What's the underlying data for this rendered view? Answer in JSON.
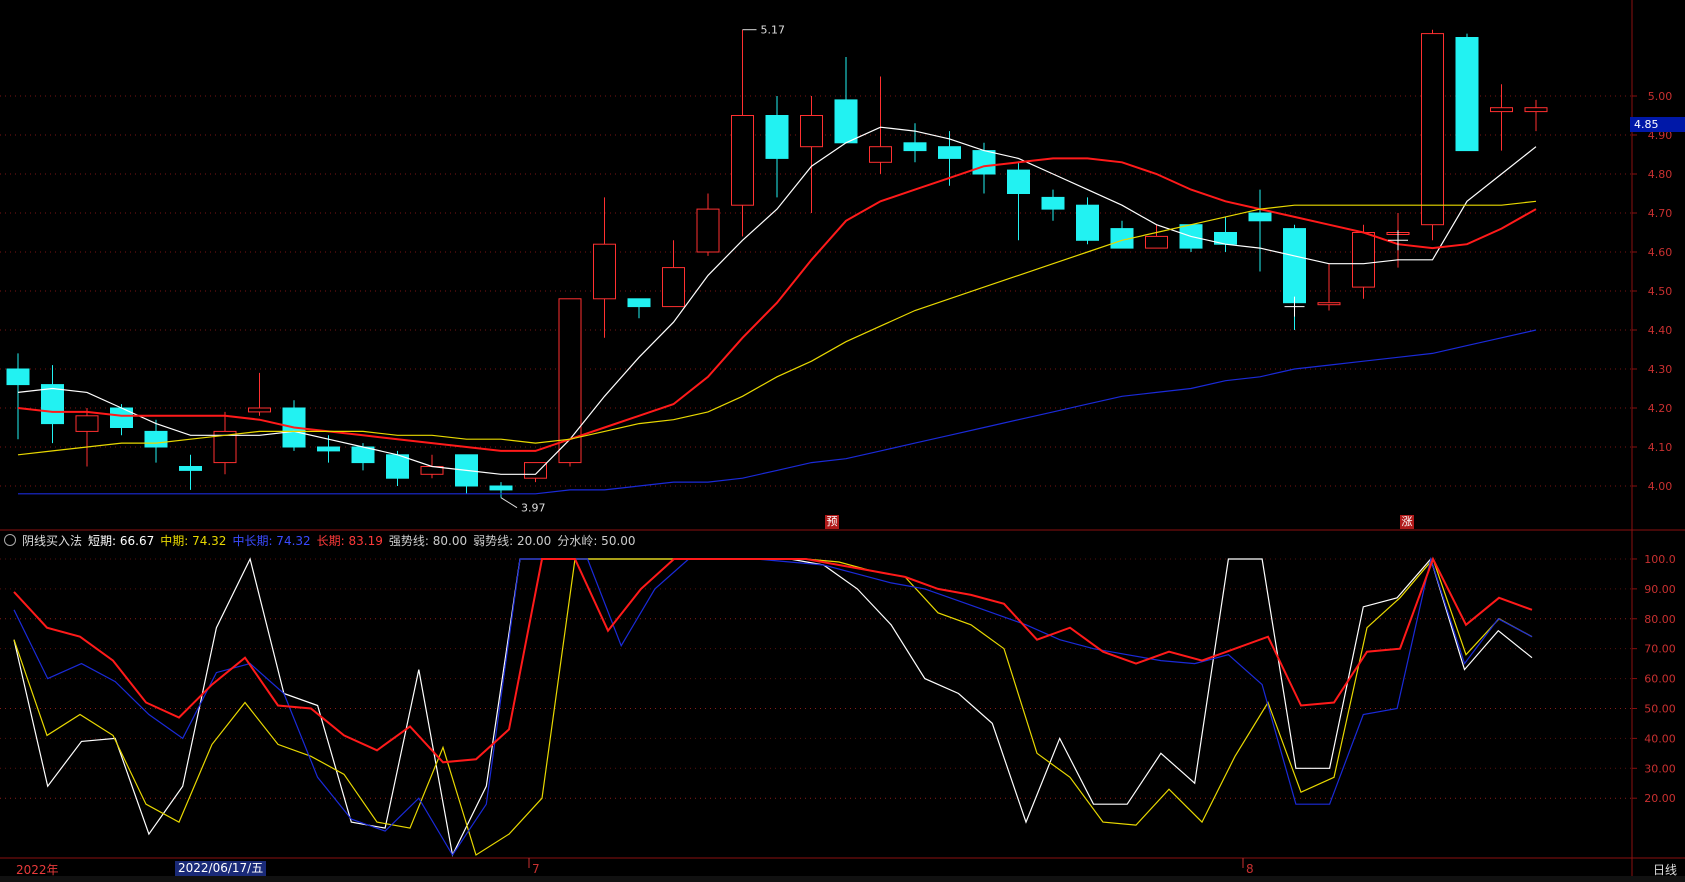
{
  "chart_data": [
    {
      "type": "candlestick",
      "ylim": [
        3.9,
        5.2
      ],
      "ticks": [
        "5.00",
        "4.90",
        "4.80",
        "4.70",
        "4.60",
        "4.50",
        "4.40",
        "4.30",
        "4.20",
        "4.10",
        "4.00"
      ],
      "tick_values": [
        5.0,
        4.9,
        4.8,
        4.7,
        4.6,
        4.5,
        4.4,
        4.3,
        4.2,
        4.1,
        4.0
      ],
      "grid": true,
      "current_price": "4.85",
      "high_label": "5.17",
      "low_label": "3.97",
      "ohlc": [
        [
          4.3,
          4.34,
          4.12,
          4.26
        ],
        [
          4.26,
          4.31,
          4.11,
          4.16
        ],
        [
          4.14,
          4.2,
          4.05,
          4.18
        ],
        [
          4.2,
          4.21,
          4.13,
          4.15
        ],
        [
          4.14,
          4.17,
          4.06,
          4.1
        ],
        [
          4.05,
          4.08,
          3.99,
          4.04
        ],
        [
          4.06,
          4.19,
          4.03,
          4.14
        ],
        [
          4.19,
          4.29,
          4.18,
          4.2
        ],
        [
          4.2,
          4.22,
          4.09,
          4.1
        ],
        [
          4.1,
          4.13,
          4.06,
          4.09
        ],
        [
          4.1,
          4.11,
          4.04,
          4.06
        ],
        [
          4.08,
          4.09,
          4.0,
          4.02
        ],
        [
          4.03,
          4.08,
          4.02,
          4.05
        ],
        [
          4.08,
          4.08,
          3.98,
          4.0
        ],
        [
          4.0,
          4.01,
          3.97,
          3.99
        ],
        [
          4.02,
          4.06,
          4.01,
          4.06
        ],
        [
          4.06,
          4.48,
          4.05,
          4.48
        ],
        [
          4.48,
          4.74,
          4.38,
          4.62
        ],
        [
          4.48,
          4.47,
          4.43,
          4.46
        ],
        [
          4.46,
          4.63,
          4.47,
          4.56
        ],
        [
          4.6,
          4.75,
          4.59,
          4.71
        ],
        [
          4.72,
          5.17,
          4.64,
          4.95
        ],
        [
          4.95,
          5.0,
          4.74,
          4.84
        ],
        [
          4.87,
          5.0,
          4.7,
          4.95
        ],
        [
          4.99,
          5.1,
          4.88,
          4.88
        ],
        [
          4.83,
          5.05,
          4.8,
          4.87
        ],
        [
          4.88,
          4.93,
          4.83,
          4.86
        ],
        [
          4.87,
          4.91,
          4.77,
          4.84
        ],
        [
          4.86,
          4.88,
          4.75,
          4.8
        ],
        [
          4.81,
          4.83,
          4.63,
          4.75
        ],
        [
          4.74,
          4.76,
          4.68,
          4.71
        ],
        [
          4.72,
          4.74,
          4.62,
          4.63
        ],
        [
          4.66,
          4.68,
          4.62,
          4.61
        ],
        [
          4.61,
          4.67,
          4.61,
          4.64
        ],
        [
          4.67,
          4.67,
          4.6,
          4.61
        ],
        [
          4.65,
          4.69,
          4.6,
          4.62
        ],
        [
          4.7,
          4.76,
          4.55,
          4.68
        ],
        [
          4.66,
          4.67,
          4.4,
          4.47
        ],
        [
          4.47,
          4.57,
          4.45,
          4.47
        ],
        [
          4.51,
          4.67,
          4.48,
          4.65
        ],
        [
          4.65,
          4.7,
          4.56,
          4.65
        ],
        [
          4.67,
          5.17,
          4.63,
          5.16
        ],
        [
          5.15,
          5.16,
          4.86,
          4.86
        ],
        [
          4.96,
          5.03,
          4.86,
          4.97
        ],
        [
          4.96,
          4.99,
          4.91,
          4.97
        ]
      ],
      "series": [
        {
          "name": "MA5",
          "color": "#ffffff",
          "values": [
            4.24,
            4.25,
            4.24,
            4.2,
            4.16,
            4.13,
            4.13,
            4.13,
            4.14,
            4.12,
            4.1,
            4.08,
            4.05,
            4.04,
            4.03,
            4.03,
            4.12,
            4.23,
            4.33,
            4.42,
            4.54,
            4.63,
            4.71,
            4.82,
            4.88,
            4.92,
            4.91,
            4.89,
            4.86,
            4.84,
            4.8,
            4.76,
            4.72,
            4.67,
            4.64,
            4.62,
            4.61,
            4.59,
            4.57,
            4.57,
            4.58,
            4.58,
            4.73,
            4.8,
            4.87
          ]
        },
        {
          "name": "MA10",
          "color": "#ff1a1a",
          "values": [
            4.2,
            4.19,
            4.19,
            4.18,
            4.18,
            4.18,
            4.18,
            4.17,
            4.15,
            4.14,
            4.13,
            4.12,
            4.11,
            4.1,
            4.09,
            4.09,
            4.12,
            4.15,
            4.18,
            4.21,
            4.28,
            4.38,
            4.47,
            4.58,
            4.68,
            4.73,
            4.76,
            4.79,
            4.82,
            4.83,
            4.84,
            4.84,
            4.83,
            4.8,
            4.76,
            4.73,
            4.71,
            4.69,
            4.67,
            4.65,
            4.62,
            4.61,
            4.62,
            4.66,
            4.71
          ]
        },
        {
          "name": "MA20",
          "color": "#e8d800",
          "values": [
            4.08,
            4.09,
            4.1,
            4.11,
            4.11,
            4.12,
            4.13,
            4.14,
            4.14,
            4.14,
            4.14,
            4.13,
            4.13,
            4.12,
            4.12,
            4.11,
            4.12,
            4.14,
            4.16,
            4.17,
            4.19,
            4.23,
            4.28,
            4.32,
            4.37,
            4.41,
            4.45,
            4.48,
            4.51,
            4.54,
            4.57,
            4.6,
            4.63,
            4.65,
            4.67,
            4.69,
            4.71,
            4.72,
            4.72,
            4.72,
            4.72,
            4.72,
            4.72,
            4.72,
            4.73
          ]
        },
        {
          "name": "MA60",
          "color": "#1a2ad8",
          "values": [
            3.98,
            3.98,
            3.98,
            3.98,
            3.98,
            3.98,
            3.98,
            3.98,
            3.98,
            3.98,
            3.98,
            3.98,
            3.98,
            3.98,
            3.98,
            3.98,
            3.99,
            3.99,
            4.0,
            4.01,
            4.01,
            4.02,
            4.04,
            4.06,
            4.07,
            4.09,
            4.11,
            4.13,
            4.15,
            4.17,
            4.19,
            4.21,
            4.23,
            4.24,
            4.25,
            4.27,
            4.28,
            4.3,
            4.31,
            4.32,
            4.33,
            4.34,
            4.36,
            4.38,
            4.4
          ]
        }
      ],
      "signals": [
        {
          "label": "预",
          "index": 23
        },
        {
          "label": "涨",
          "index": 41
        }
      ]
    },
    {
      "type": "line",
      "title": "阴线买入法",
      "ylim": [
        0,
        103
      ],
      "ticks": [
        "100.0",
        "90.00",
        "80.00",
        "70.00",
        "60.00",
        "50.00",
        "40.00",
        "30.00",
        "20.00"
      ],
      "tick_values": [
        100,
        90,
        80,
        70,
        60,
        50,
        40,
        30,
        20
      ],
      "reference_lines": [
        80,
        50,
        20
      ],
      "legend": [
        {
          "label": "短期: 66.67",
          "color": "#ffffff"
        },
        {
          "label": "中期: 74.32",
          "color": "#e8d800"
        },
        {
          "label": "中长期: 74.32",
          "color": "#2a3aff"
        },
        {
          "label": "长期: 83.19",
          "color": "#ff2a2a"
        },
        {
          "label": "强势线: 80.00",
          "color": "#cccccc"
        },
        {
          "label": "弱势线: 20.00",
          "color": "#cccccc"
        },
        {
          "label": "分水岭: 50.00",
          "color": "#cccccc"
        }
      ],
      "series": [
        {
          "name": "短期",
          "color": "#ffffff",
          "values": [
            73,
            24,
            39,
            40,
            8,
            24,
            77,
            100,
            55,
            51,
            12,
            10,
            63,
            1,
            24,
            100,
            100,
            100,
            100,
            100,
            100,
            100,
            100,
            100,
            98,
            90,
            78,
            60,
            55,
            45,
            12,
            40,
            18,
            18,
            35,
            25,
            100,
            100,
            30,
            30,
            84,
            87,
            100,
            63,
            76,
            67
          ]
        },
        {
          "name": "中期",
          "color": "#e8d800",
          "values": [
            73,
            41,
            48,
            41,
            18,
            12,
            38,
            52,
            38,
            34,
            28,
            12,
            10,
            37,
            1,
            8,
            20,
            100,
            100,
            100,
            100,
            100,
            100,
            100,
            100,
            99,
            96,
            94,
            82,
            78,
            70,
            35,
            27,
            12,
            11,
            23,
            12,
            34,
            52,
            22,
            27,
            77,
            87,
            100,
            68,
            80,
            74
          ]
        },
        {
          "name": "中长期",
          "color": "#1a2ad8",
          "values": [
            83,
            60,
            65,
            59,
            48,
            40,
            62,
            65,
            55,
            27,
            13,
            9,
            20,
            1,
            18,
            100,
            100,
            100,
            71,
            90,
            100,
            100,
            100,
            99,
            98,
            95,
            92,
            90,
            86,
            82,
            78,
            73,
            70,
            68,
            66,
            65,
            68,
            58,
            18,
            18,
            48,
            50,
            100,
            65,
            80,
            74
          ]
        },
        {
          "name": "长期",
          "color": "#ff1a1a",
          "values": [
            89,
            77,
            74,
            66,
            52,
            47,
            58,
            67,
            51,
            50,
            41,
            36,
            44,
            32,
            33,
            43,
            100,
            100,
            76,
            90,
            100,
            100,
            100,
            100,
            100,
            98,
            96,
            94,
            90,
            88,
            85,
            73,
            77,
            69,
            65,
            69,
            66,
            70,
            74,
            51,
            52,
            69,
            70,
            100,
            78,
            87,
            83
          ]
        }
      ]
    }
  ],
  "axis_labels": {
    "year": "2022年",
    "date": "2022/06/17/五",
    "month_7": "7",
    "month_8": "8"
  },
  "mode": "日线"
}
